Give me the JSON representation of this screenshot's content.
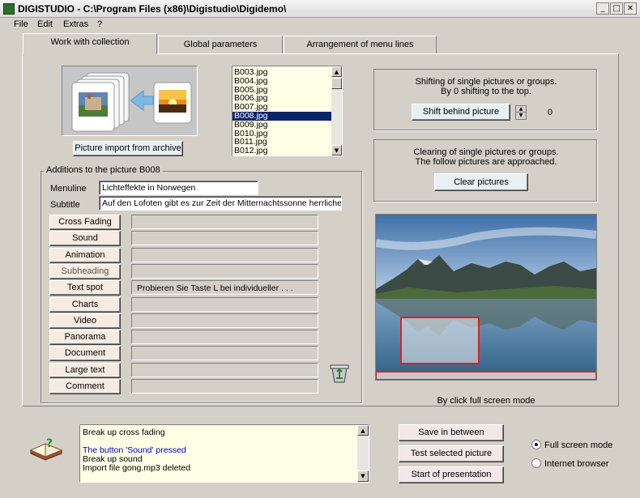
{
  "window": {
    "title": "DIGISTUDIO - C:\\Program Files (x86)\\Digistudio\\Digidemo\\",
    "controls": [
      "_",
      "□",
      "✕"
    ]
  },
  "menu": [
    "File",
    "Edit",
    "Extras",
    "?"
  ],
  "tabs": [
    "Work with collection",
    "Global parameters",
    "Arrangement of menu lines"
  ],
  "import": {
    "button": "Picture import from archive"
  },
  "filelist": {
    "items": [
      "B003.jpg",
      "B004.jpg",
      "B005.jpg",
      "B006.jpg",
      "B007.jpg",
      "B008.jpg",
      "B009.jpg",
      "B010.jpg",
      "B011.jpg",
      "B012.jpg"
    ],
    "selected": "B008.jpg"
  },
  "shift": {
    "text_line1": "Shifting of single pictures or groups.",
    "text_line2": "By 0 shifting to the top.",
    "button": "Shift behind picture",
    "value": "0"
  },
  "clear": {
    "text_line1": "Clearing of single pictures or groups.",
    "text_line2": "The follow pictures are approached.",
    "button": "Clear pictures"
  },
  "additions": {
    "group_label": "Additions to the picture B008",
    "menuline_label": "Menuline",
    "menuline_value": "Lichteffekte in Norwegen",
    "subtitle_label": "Subtitle",
    "subtitle_value": "Auf den Lofoten gibt es zur Zeit der Mitternachtssonne herrliche Spiegelur",
    "buttons": [
      {
        "label": "Cross Fading",
        "value": ""
      },
      {
        "label": "Sound",
        "value": ""
      },
      {
        "label": "Animation",
        "value": ""
      },
      {
        "label": "Subheading",
        "value": ""
      },
      {
        "label": "Text spot",
        "value": "Probieren Sie Taste L bei individueller . . ."
      },
      {
        "label": "Charts",
        "value": ""
      },
      {
        "label": "Video",
        "value": ""
      },
      {
        "label": "Panorama",
        "value": ""
      },
      {
        "label": "Document",
        "value": ""
      },
      {
        "label": "Large text",
        "value": ""
      },
      {
        "label": "Comment",
        "value": ""
      }
    ]
  },
  "preview": {
    "caption": "By click full screen mode"
  },
  "log": {
    "lines": [
      {
        "text": "Break up cross fading",
        "color": "#000000"
      },
      {
        "text": "",
        "color": "#000000"
      },
      {
        "text": "The button 'Sound' pressed",
        "color": "#0000cc"
      },
      {
        "text": "Break up sound",
        "color": "#000000"
      },
      {
        "text": "Import file gong.mp3 deleted",
        "color": "#000000"
      }
    ]
  },
  "actions": {
    "save": "Save in between",
    "test": "Test selected picture",
    "start": "Start of presentation"
  },
  "mode": {
    "fullscreen": "Full screen mode",
    "browser": "Internet browser",
    "selected": "fullscreen"
  }
}
